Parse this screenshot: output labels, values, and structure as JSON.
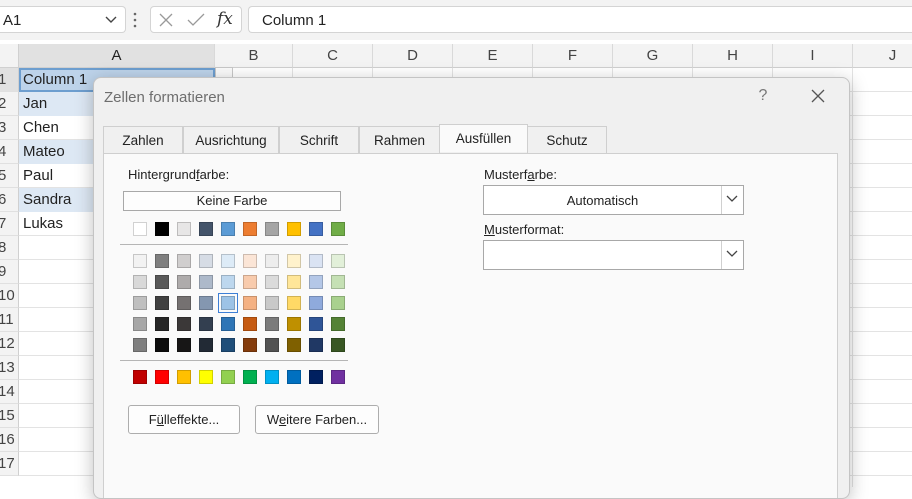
{
  "formula_bar": {
    "name_box": "A1",
    "fx_symbol": "fx",
    "formula": "Column 1"
  },
  "sheet": {
    "columns": [
      "A",
      "B",
      "C",
      "D",
      "E",
      "F",
      "G",
      "H",
      "I",
      "J"
    ],
    "rows": [
      "1",
      "2",
      "3",
      "4",
      "5",
      "6",
      "7",
      "8",
      "9",
      "10",
      "11",
      "12",
      "13",
      "14",
      "15",
      "16",
      "17"
    ],
    "cells": [
      "Column 1",
      "Jan",
      "Chen",
      "Mateo",
      "Paul",
      "Sandra",
      "Lukas"
    ]
  },
  "dialog": {
    "title": "Zellen formatieren",
    "help": "?",
    "tabs": [
      "Zahlen",
      "Ausrichtung",
      "Schrift",
      "Rahmen",
      "Ausfüllen",
      "Schutz"
    ],
    "active_tab": "Ausfüllen",
    "background_label_pre": "Hintergrund",
    "background_label_u": "f",
    "background_label_post": "arbe:",
    "no_color": "Keine Farbe",
    "pattern_color_label_pre": "Musterf",
    "pattern_color_label_u": "a",
    "pattern_color_label_post": "rbe:",
    "pattern_color_value": "Automatisch",
    "pattern_style_label_pre": "",
    "pattern_style_label_u": "M",
    "pattern_style_label_post": "usterformat:",
    "pattern_style_value": "",
    "fill_effects_pre": "F",
    "fill_effects_u": "ü",
    "fill_effects_post": "lleffekte...",
    "more_colors_pre": "W",
    "more_colors_u": "e",
    "more_colors_post": "itere Farben...",
    "selected_swatch": "#9dc3e6"
  },
  "palette": {
    "theme_top": [
      "#ffffff",
      "#000000",
      "#e7e6e6",
      "#44546a",
      "#5b9bd5",
      "#ed7d31",
      "#a5a5a5",
      "#ffc000",
      "#4472c4",
      "#70ad47"
    ],
    "tints": [
      [
        "#f2f2f2",
        "#7f7f7f",
        "#d0cece",
        "#d6dce5",
        "#ddebf7",
        "#fbe5d6",
        "#ededed",
        "#fff2cc",
        "#dae3f3",
        "#e2f0d9"
      ],
      [
        "#d9d9d9",
        "#595959",
        "#aeabab",
        "#adb9ca",
        "#bdd7ee",
        "#f8cbad",
        "#dbdbdb",
        "#ffe699",
        "#b4c7e7",
        "#c5e0b4"
      ],
      [
        "#bfbfbf",
        "#404040",
        "#757171",
        "#8497b0",
        "#9dc3e6",
        "#f4b183",
        "#c9c9c9",
        "#ffd966",
        "#8faadc",
        "#a9d18e"
      ],
      [
        "#a6a6a6",
        "#262626",
        "#3b3838",
        "#333f50",
        "#2e75b6",
        "#c55a11",
        "#7b7b7b",
        "#bf9000",
        "#2f5597",
        "#548235"
      ],
      [
        "#7f7f7f",
        "#0d0d0d",
        "#171616",
        "#222a35",
        "#1f4e79",
        "#843c0c",
        "#525252",
        "#7f6000",
        "#203864",
        "#385723"
      ]
    ],
    "standard": [
      "#c00000",
      "#ff0000",
      "#ffc000",
      "#ffff00",
      "#92d050",
      "#00b050",
      "#00b0f0",
      "#0070c0",
      "#002060",
      "#7030a0"
    ]
  }
}
